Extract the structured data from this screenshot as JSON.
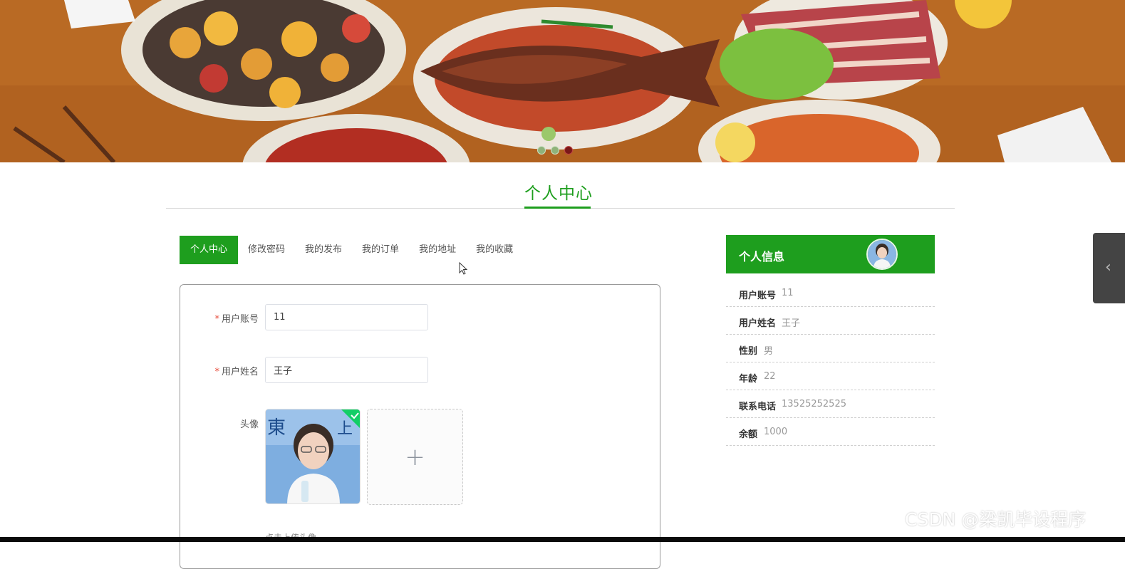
{
  "banner": {
    "dots": [
      {
        "active": false
      },
      {
        "active": false
      },
      {
        "active": true
      }
    ]
  },
  "section": {
    "title": "个人中心"
  },
  "tabs": [
    {
      "label": "个人中心",
      "active": true
    },
    {
      "label": "修改密码",
      "active": false
    },
    {
      "label": "我的发布",
      "active": false
    },
    {
      "label": "我的订单",
      "active": false
    },
    {
      "label": "我的地址",
      "active": false
    },
    {
      "label": "我的收藏",
      "active": false
    }
  ],
  "form": {
    "account_label": "用户账号",
    "account_value": "11",
    "name_label": "用户姓名",
    "name_value": "王子",
    "avatar_label": "头像",
    "upload_plus": "+",
    "upload_hint": "点击上传头像"
  },
  "info": {
    "title": "个人信息",
    "rows": [
      {
        "key": "用户账号",
        "value": "11"
      },
      {
        "key": "用户姓名",
        "value": "王子"
      },
      {
        "key": "性别",
        "value": "男"
      },
      {
        "key": "年龄",
        "value": "22"
      },
      {
        "key": "联系电话",
        "value": "13525252525"
      },
      {
        "key": "余额",
        "value": "1000"
      }
    ]
  },
  "side_toggle": {
    "icon": "chevron-left-icon",
    "glyph": "‹"
  },
  "watermark": "CSDN @梁凯毕设程序",
  "colors": {
    "accent": "#1e9e1e"
  }
}
